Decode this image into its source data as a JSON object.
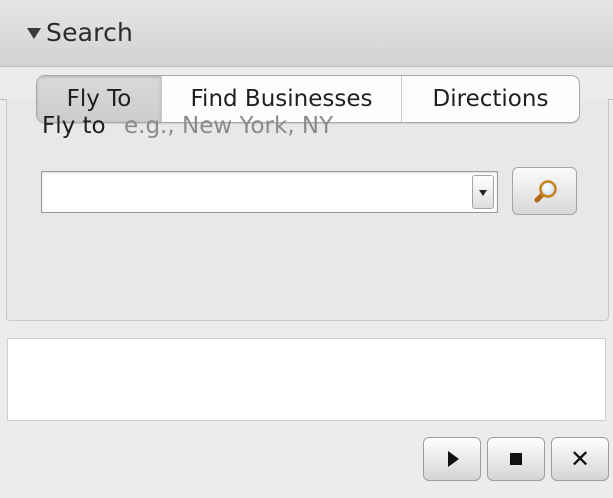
{
  "header": {
    "title": "Search",
    "toggle_icon": "disclosure-triangle-down-icon"
  },
  "tabs": [
    {
      "label": "Fly To",
      "selected": true
    },
    {
      "label": "Find Businesses",
      "selected": false
    },
    {
      "label": "Directions",
      "selected": false
    }
  ],
  "flyto": {
    "label": "Fly to",
    "hint": "e.g., New York, NY",
    "input_value": "",
    "dropdown_icon": "chevron-down-icon",
    "search_icon": "magnifier-icon"
  },
  "controls": {
    "play_icon": "play-icon",
    "stop_icon": "stop-icon",
    "close_icon": "close-icon",
    "close_glyph": "✕"
  },
  "colors": {
    "panel_bg": "#ececec",
    "header_bg": "#d9d9d9",
    "hint_text": "#8a8a8a"
  }
}
